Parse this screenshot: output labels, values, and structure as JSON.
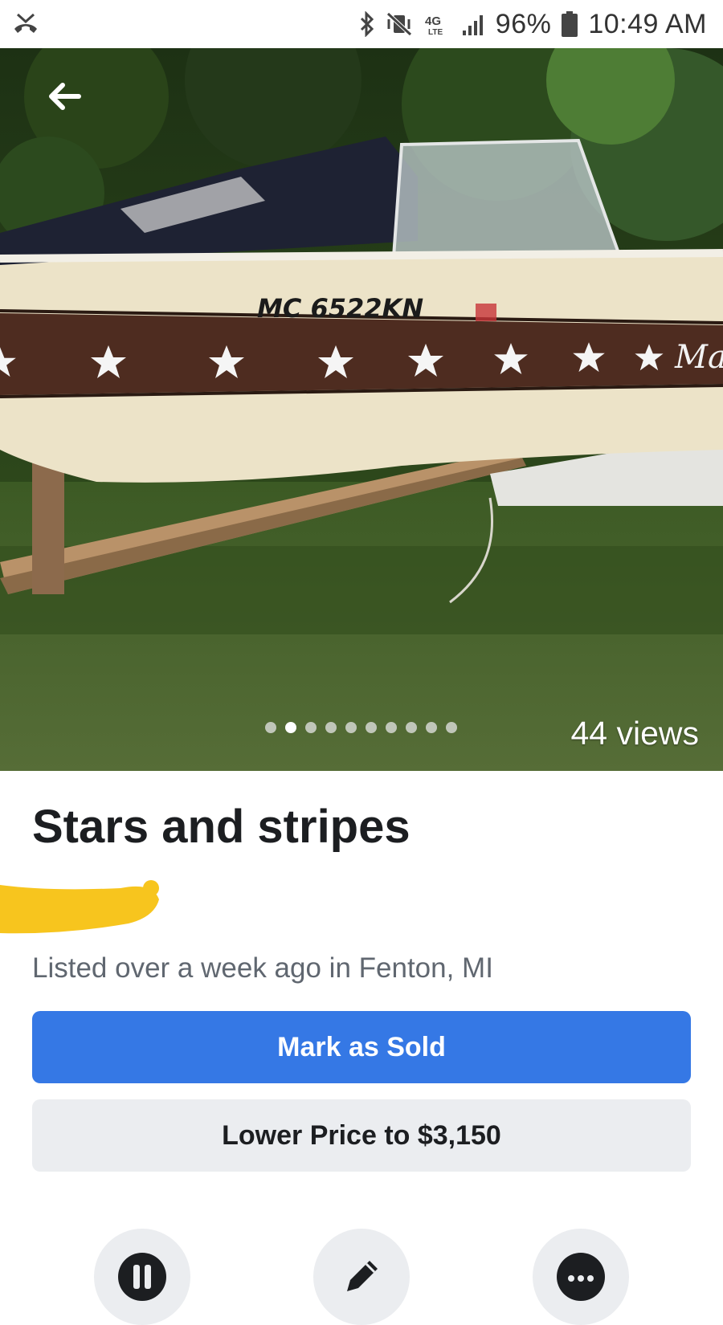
{
  "status_bar": {
    "signal_label": "4G LTE",
    "battery": "96%",
    "time": "10:49 AM"
  },
  "photo": {
    "hull_registration": "MC 6522KN",
    "hull_brand_partial": "Mas",
    "image_count": 10,
    "current_image_index": 1,
    "views": "44 views"
  },
  "listing": {
    "title": "Stars and stripes",
    "listed": "Listed over a week ago in Fenton, MI"
  },
  "buttons": {
    "mark_sold": "Mark as Sold",
    "lower_price": "Lower Price to $3,150"
  },
  "icons": {
    "back": "arrow-left-icon",
    "pause": "pause-icon",
    "edit": "pencil-icon",
    "more": "more-icon"
  },
  "colors": {
    "primary": "#3578e5",
    "secondary_bg": "#ebedf0",
    "redaction": "#f7c51e"
  }
}
